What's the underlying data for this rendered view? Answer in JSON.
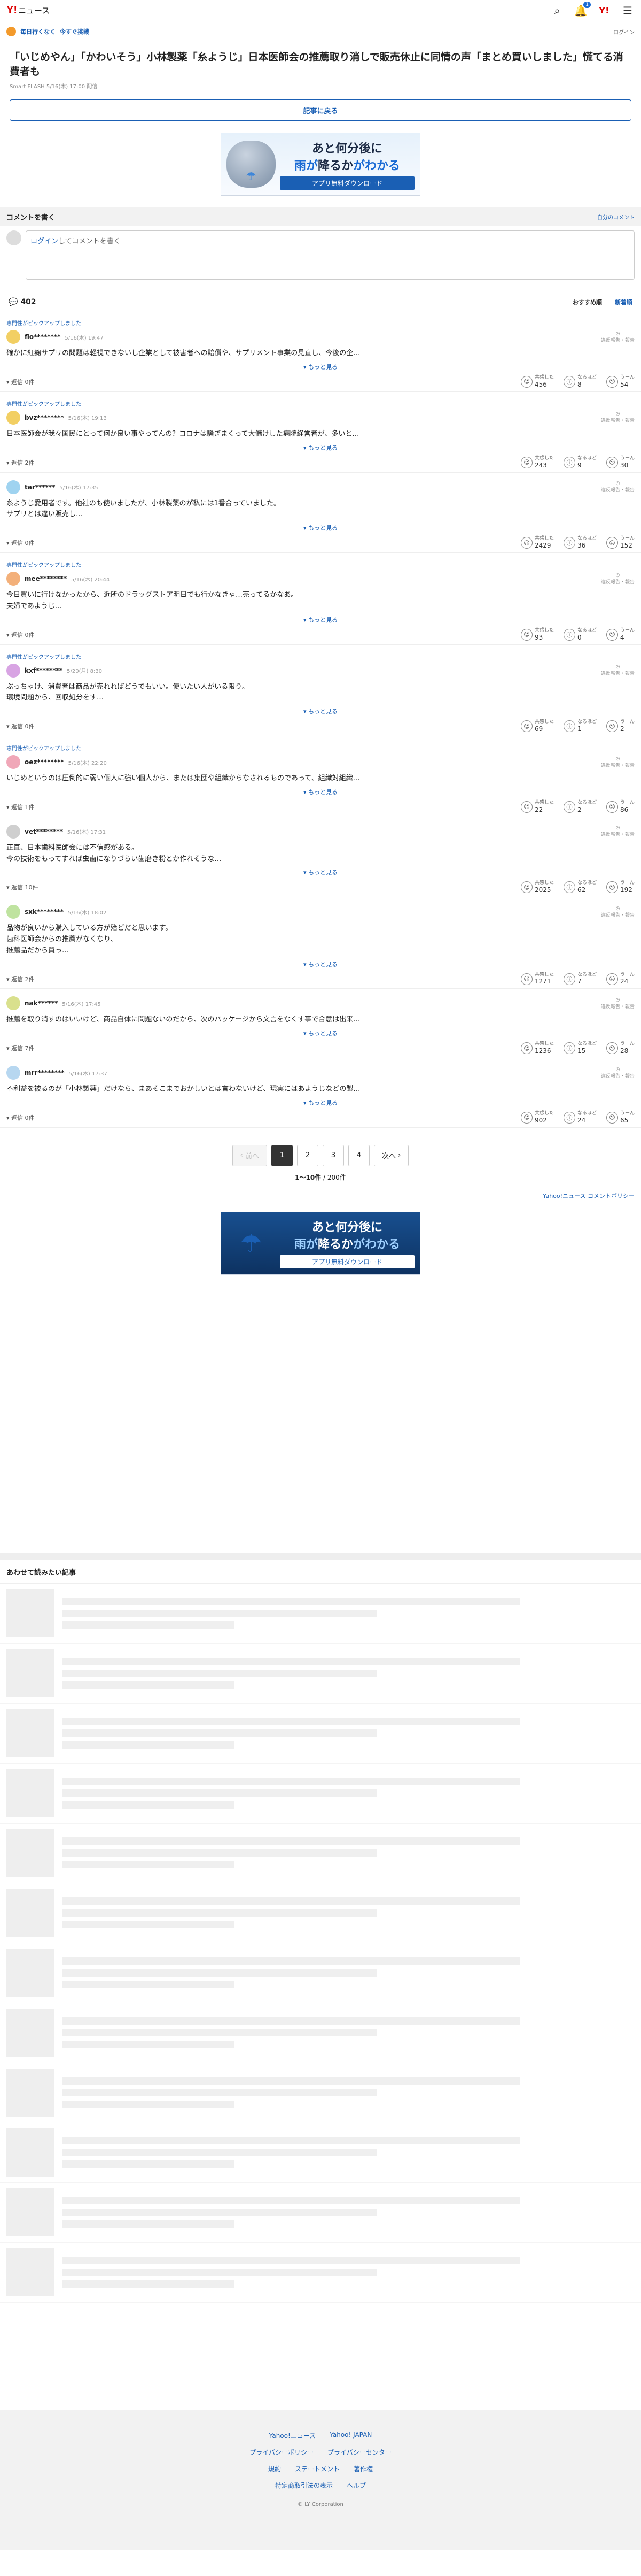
{
  "header": {
    "logo": "Y!",
    "logo_sub": "ニュース",
    "notif_count": "1",
    "ymark": "Y!"
  },
  "promo": {
    "mark": "毎日行くなく",
    "label": "今すぐ挑戦",
    "right": "ログイン"
  },
  "article": {
    "title": "「いじめやん」「かわいそう」小林製薬「糸ようじ」日本医師会の推薦取り消しで販売休止に同情の声「まとめ買いしました」慌てる消費者も",
    "meta": "Smart FLASH 5/16(木) 17:00 配信",
    "back_label": "記事に戻る"
  },
  "ad": {
    "line1": "あと何分後に",
    "line2a": "雨が",
    "line2b": "降るか",
    "line2c": "がわかる",
    "download": "アプリ無料ダウンロード"
  },
  "comment_section": {
    "title": "コメントを書く",
    "own_link": "自分のコメント",
    "login": "ログイン",
    "placeholder_suffix": "してコメントを書く",
    "count": "402",
    "sort_recommend": "おすすめ順",
    "sort_new": "新着順"
  },
  "comments": [
    {
      "pick": "専門性がピックアップしました",
      "name": "flo********",
      "date": "5/16(木) 19:47",
      "body": "確かに紅麹サプリの問題は軽視できないし企業として被害者への賠償や、サプリメント事業の見直し、今後の企…",
      "replies": "返信 0件",
      "like": "456",
      "neutral": "8",
      "dislike": "54"
    },
    {
      "pick": "専門性がピックアップしました",
      "name": "bvz********",
      "date": "5/16(木) 19:13",
      "body": "日本医師会が我々国民にとって何か良い事やってんの？コロナは騒ぎまくって大儲けした病院経営者が、多いと…",
      "replies": "返信 2件",
      "like": "243",
      "neutral": "9",
      "dislike": "30"
    },
    {
      "pick": "",
      "name": "tar******",
      "date": "5/16(木) 17:35",
      "body": "糸ようじ愛用者です。他社のも使いましたが、小林製薬のが私には1番合っていました。\nサプリとは違い販売し…",
      "replies": "返信 0件",
      "like": "2429",
      "neutral": "36",
      "dislike": "152"
    },
    {
      "pick": "専門性がピックアップしました",
      "name": "mee********",
      "date": "5/16(木) 20:44",
      "body": "今日買いに行けなかったから、近所のドラッグストア明日でも行かなきゃ…売ってるかなあ。\n夫婦であようじ…",
      "replies": "返信 0件",
      "like": "93",
      "neutral": "0",
      "dislike": "4"
    },
    {
      "pick": "専門性がピックアップしました",
      "name": "kxf********",
      "date": "5/20(月) 8:30",
      "body": "ぶっちゃけ、消費者は商品が売れればどうでもいい。使いたい人がいる限り。\n環境問題から、回収処分をす…",
      "replies": "返信 0件",
      "like": "69",
      "neutral": "1",
      "dislike": "2"
    },
    {
      "pick": "専門性がピックアップしました",
      "name": "oez********",
      "date": "5/16(木) 22:20",
      "body": "いじめというのは圧倒的に弱い個人に強い個人から、または集団や組織からなされるものであって、組織対組織…",
      "replies": "返信 1件",
      "like": "22",
      "neutral": "2",
      "dislike": "86"
    },
    {
      "pick": "",
      "name": "vet********",
      "date": "5/16(木) 17:31",
      "body": "正直、日本歯科医師会には不信感がある。\n今の技術をもってすれば虫歯になりづらい歯磨き粉とか作れそうな…",
      "replies": "返信 10件",
      "like": "2025",
      "neutral": "62",
      "dislike": "192"
    },
    {
      "pick": "",
      "name": "sxk********",
      "date": "5/16(木) 18:02",
      "body": "品物が良いから購入している方が殆どだと思います。\n歯科医師会からの推薦がなくなり、\n推薦品だから買っ…",
      "replies": "返信 2件",
      "like": "1271",
      "neutral": "7",
      "dislike": "24"
    },
    {
      "pick": "",
      "name": "nak******",
      "date": "5/16(木) 17:45",
      "body": "推薦を取り消すのはいいけど、商品自体に問題ないのだから、次のパッケージから文言をなくす事で合意は出来…",
      "replies": "返信 7件",
      "like": "1236",
      "neutral": "15",
      "dislike": "28"
    },
    {
      "pick": "",
      "name": "mrr********",
      "date": "5/16(木) 17:37",
      "body": "不利益を被るのが「小林製薬」だけなら、まあそこまでおかしいとは言わないけど、現実にはあようじなどの製…",
      "replies": "返信 0件",
      "like": "902",
      "neutral": "24",
      "dislike": "65"
    }
  ],
  "labels": {
    "more": "もっと見る",
    "like": "共感した",
    "neutral": "なるほど",
    "dislike": "うーん",
    "report": "違反報告・報告"
  },
  "pager": {
    "prev": "前へ",
    "pages": [
      "1",
      "2",
      "3",
      "4"
    ],
    "next": "次へ",
    "range": "1〜10件",
    "total": "200件"
  },
  "policy_link": "Yahoo!ニュース コメントポリシー",
  "recommend_title": "あわせて読みたい記事",
  "footer": {
    "brand": "Yahoo!ニュース",
    "brand2": "Yahoo! JAPAN",
    "links1": [
      "プライバシーポリシー",
      "プライバシーセンター"
    ],
    "links2": [
      "規約",
      "ステートメント",
      "著作権"
    ],
    "links3": [
      "特定商取引法の表示",
      "ヘルプ"
    ],
    "copyright": "© LY Corporation"
  }
}
